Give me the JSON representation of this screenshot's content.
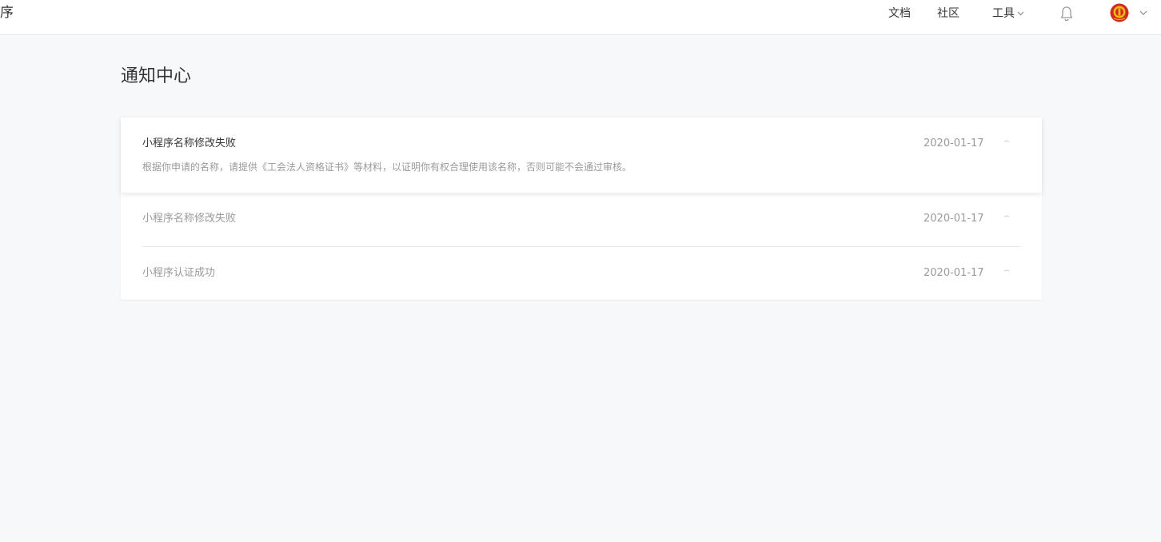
{
  "header": {
    "brand": "序",
    "nav": {
      "docs": "文档",
      "community": "社区",
      "tools": "工具"
    }
  },
  "page": {
    "title": "通知中心"
  },
  "notices": [
    {
      "title": "小程序名称修改失败",
      "date": "2020-01-17",
      "body": "根据你申请的名称，请提供《工会法人资格证书》等材料，以证明你有权合理使用该名称，否则可能不会通过审核。"
    },
    {
      "title": "小程序名称修改失败",
      "date": "2020-01-17"
    },
    {
      "title": "小程序认证成功",
      "date": "2020-01-17"
    }
  ],
  "colors": {
    "background": "#f7f8fa",
    "text": "#353535",
    "muted": "#9a9a9a",
    "avatar_red": "#d42a1e",
    "avatar_gold": "#f0b91a"
  }
}
